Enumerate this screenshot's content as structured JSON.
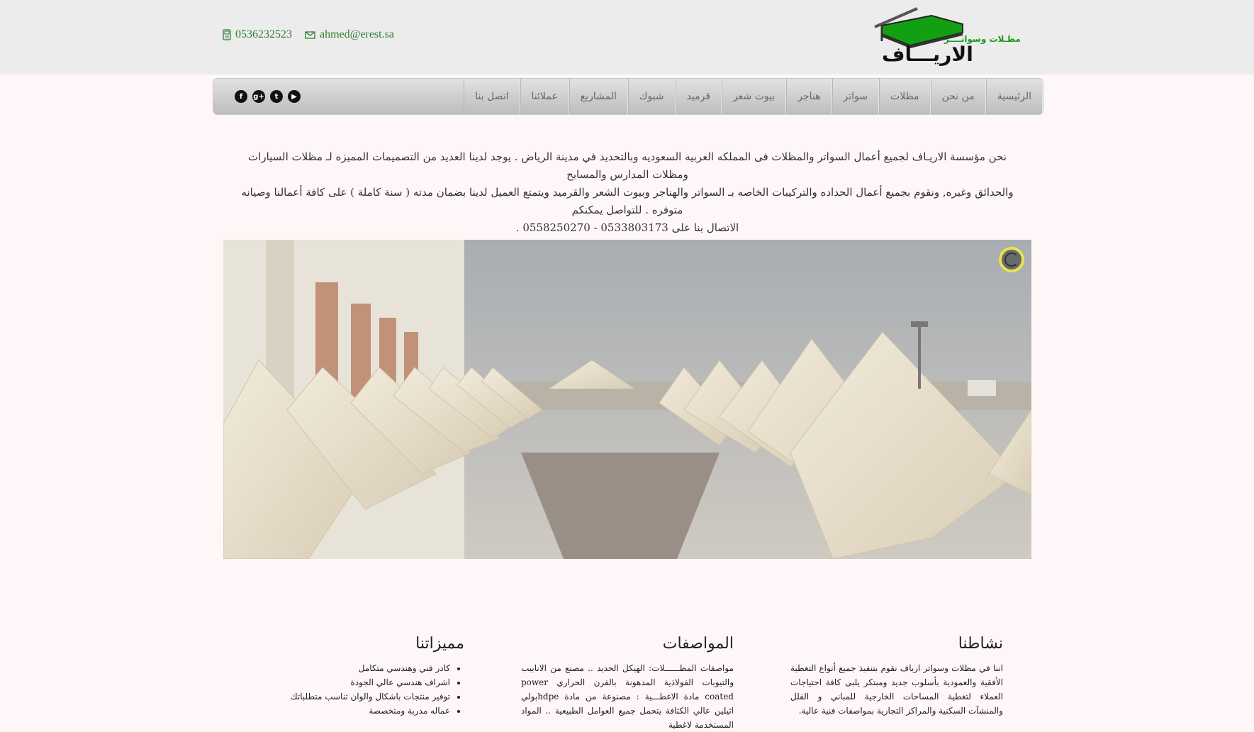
{
  "header": {
    "phone": "0536232523",
    "email": "ahmed@erest.sa",
    "logo_tagline": "مظـلات وسواتــــر",
    "logo_name": "الاريـــاف",
    "colors": {
      "bar": "#ececec",
      "accent": "#2f7d2f",
      "logo_green": "#1a9a1a"
    }
  },
  "nav": {
    "items": [
      {
        "label": "الرئيسية"
      },
      {
        "label": "من نحن"
      },
      {
        "label": "مظلات"
      },
      {
        "label": "سواتر"
      },
      {
        "label": "هناجر"
      },
      {
        "label": "بيوت شعر"
      },
      {
        "label": "قرميد"
      },
      {
        "label": "شبوك"
      },
      {
        "label": "المشاريع"
      },
      {
        "label": "عملائنا"
      },
      {
        "label": "اتصل بنا"
      }
    ],
    "social": [
      {
        "icon": "facebook-icon",
        "glyph": "f"
      },
      {
        "icon": "google-plus-icon",
        "glyph": "g+"
      },
      {
        "icon": "twitter-icon",
        "glyph": "t"
      },
      {
        "icon": "youtube-icon",
        "glyph": "▶"
      }
    ]
  },
  "intro": {
    "line1": "نحن مؤسسة الاريـاف لجميع أعمال السواتر والمظلات فى المملكه العربيه السعوديه وبالتحديد في مدينة الرياض . يوجد لدينا العديد من التصميمات المميزه لـ مظلات السيارات ومظلات المدارس والمسابح",
    "line2": "والحدائق وغيره, ونقوم بجميع أعمال الحداده والتركيبات الخاصه بـ السواتر والهناجر وبيوت الشعر والقرميد ويتمتع العميل لدينا بضمان مدته ( سنة كاملة ) على كافة أعمالنا وصيانه متوفره . للتواصل يمكنكم",
    "line3": "الاتصال بنا على 0533803173 - 0558250270 ."
  },
  "slider": {
    "image_alt": "tent-shades-photo"
  },
  "sections": {
    "activity": {
      "title": "نشاطنا",
      "text": "اننا في مظلات وسواتر ارياف نقوم بتنفيذ جميع أنواع التغطية الأفقية والعمودية بأسلوب جديد ومبتكر يلبى كافة احتياجات العملاء لتغطية المساحات الخارجية للمباني و الفلل والمنشآت السكنية والمراكز التجارية بمواصفات فنية عالية."
    },
    "specs": {
      "title": "المواصفات",
      "text": "مواصفات المظــــــلات: الهيكل الحديد .. مصنع من الانابيب والتيوبات الفولاذية المدهونة بالفرن الحراري power coated مادة الاغطـــية : مصنوعة من مادة hdpeبولي اثيلين عالي الكثافة يتحمل جميع العوامل الطبيعية .. المواد المستخدمة لاغطية"
    },
    "features": {
      "title": "مميزاتنا",
      "items": [
        "كادر فني وهندسي متكامل",
        "اشراف هندسي عالي الجودة",
        "توفير منتجات باشكال والوان تناسب متطلباتك",
        "عماله مدربة ومتخصصة"
      ]
    }
  }
}
